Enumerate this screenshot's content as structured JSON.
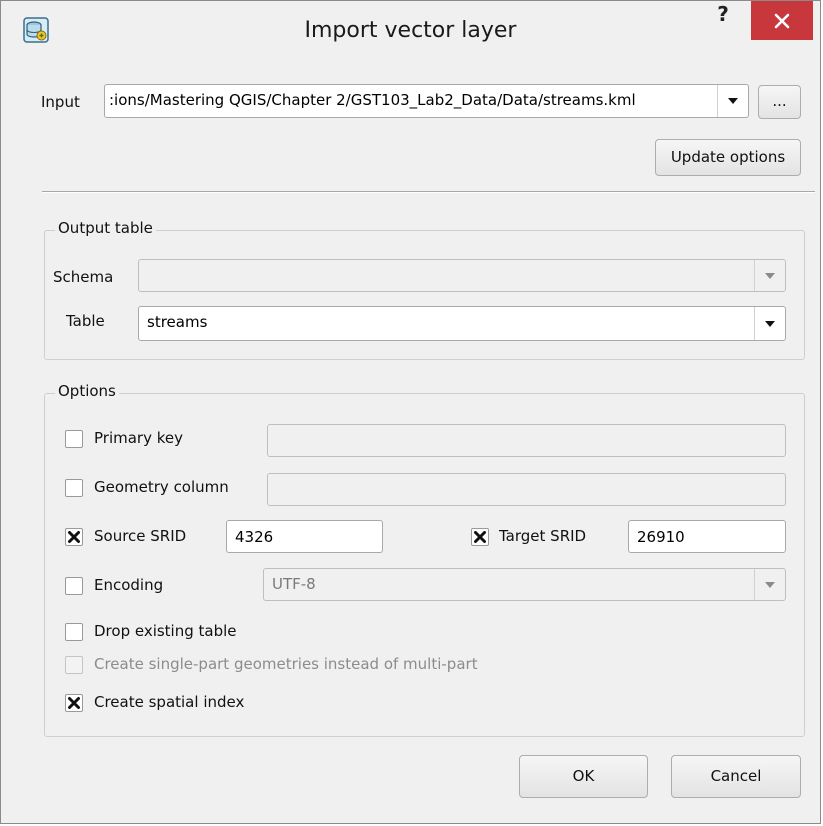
{
  "window": {
    "title": "Import vector layer",
    "help_label": "?",
    "close_label": "✕"
  },
  "input": {
    "label": "Input",
    "value": ":ions/Mastering QGIS/Chapter 2/GST103_Lab2_Data/Data/streams.kml",
    "browse_label": "...",
    "update_options_label": "Update options"
  },
  "output_table": {
    "title": "Output table",
    "schema_label": "Schema",
    "schema_value": "",
    "table_label": "Table",
    "table_value": "streams"
  },
  "options": {
    "title": "Options",
    "primary_key": {
      "label": "Primary key",
      "checked": false,
      "value": ""
    },
    "geometry_column": {
      "label": "Geometry column",
      "checked": false,
      "value": ""
    },
    "source_srid": {
      "label": "Source SRID",
      "checked": true,
      "value": "4326"
    },
    "target_srid": {
      "label": "Target SRID",
      "checked": true,
      "value": "26910"
    },
    "encoding": {
      "label": "Encoding",
      "checked": false,
      "value": "UTF-8"
    },
    "drop_existing_table": {
      "label": "Drop existing table",
      "checked": false
    },
    "single_part": {
      "label": "Create single-part geometries instead of multi-part",
      "checked": false,
      "enabled": false
    },
    "spatial_index": {
      "label": "Create spatial index",
      "checked": true
    }
  },
  "buttons": {
    "ok_label": "OK",
    "cancel_label": "Cancel"
  },
  "colors": {
    "close_button": "#c7373c",
    "dialog_background": "#f0f0f0"
  }
}
